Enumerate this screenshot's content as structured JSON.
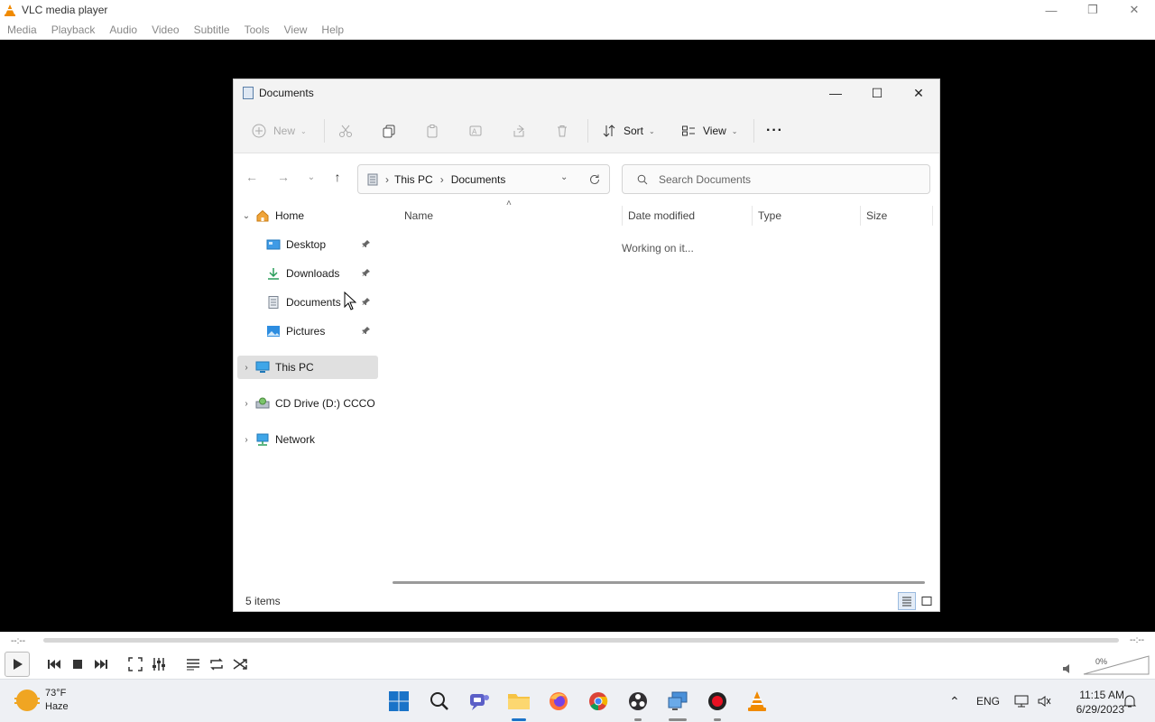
{
  "vlc": {
    "title": "VLC media player",
    "menu": [
      "Media",
      "Playback",
      "Audio",
      "Video",
      "Subtitle",
      "Tools",
      "View",
      "Help"
    ],
    "time_elapsed": "--:--",
    "time_total": "--:--",
    "volume_percent": "0%",
    "volume_level": 0
  },
  "explorer": {
    "title": "Documents",
    "toolbar": {
      "new_label": "New",
      "sort_label": "Sort",
      "view_label": "View",
      "more_label": "···"
    },
    "address": {
      "segments": [
        "This PC",
        "Documents"
      ]
    },
    "search": {
      "placeholder": "Search Documents"
    },
    "nav": {
      "home": "Home",
      "quick": [
        {
          "label": "Desktop",
          "icon": "desktop-icon"
        },
        {
          "label": "Downloads",
          "icon": "download-icon"
        },
        {
          "label": "Documents",
          "icon": "document-icon"
        },
        {
          "label": "Pictures",
          "icon": "pictures-icon"
        }
      ],
      "this_pc": "This PC",
      "cd_drive": "CD Drive (D:) CCCO",
      "network": "Network"
    },
    "columns": [
      "Name",
      "Date modified",
      "Type",
      "Size"
    ],
    "loading_text": "Working on it...",
    "status": "5 items"
  },
  "taskbar": {
    "weather_temp": "73°F",
    "weather_desc": "Haze",
    "language": "ENG",
    "time": "11:15 AM",
    "date": "6/29/2023"
  },
  "colors": {
    "accent": "#1a73c8",
    "vlc_orange": "#f08a00",
    "selection": "#e0e0e0"
  }
}
